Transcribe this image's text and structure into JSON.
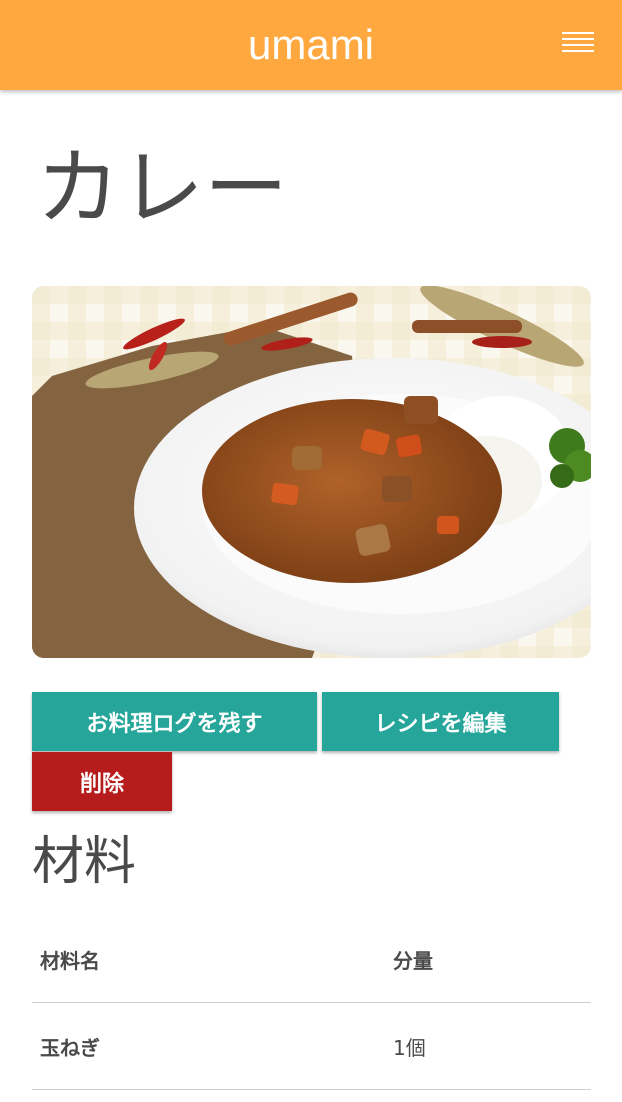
{
  "header": {
    "brand": "umami",
    "menu_icon": "hamburger-menu-icon"
  },
  "recipe": {
    "title": "カレー",
    "image_alt": "カレー"
  },
  "actions": {
    "log_label": "お料理ログを残す",
    "edit_label": "レシピを編集",
    "delete_label": "削除"
  },
  "ingredients": {
    "section_title": "材料",
    "columns": [
      "材料名",
      "分量"
    ],
    "rows": [
      {
        "name": "玉ねぎ",
        "amount": "1個"
      }
    ]
  },
  "colors": {
    "header": "#ffa83f",
    "primary_button": "#26a69a",
    "danger_button": "#b71c1c"
  }
}
